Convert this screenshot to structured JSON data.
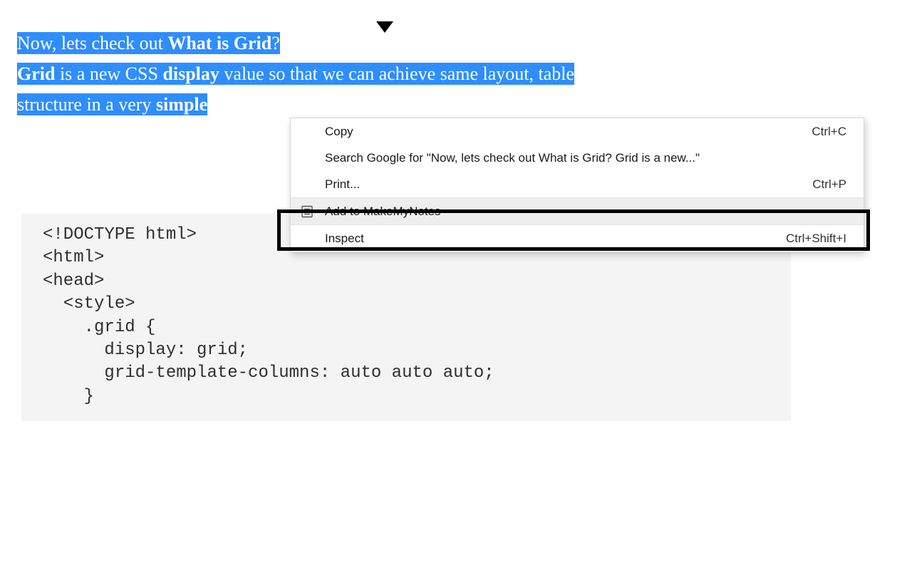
{
  "article": {
    "line1_prefix": "Now, lets check out ",
    "line1_bold": "What is Grid",
    "line1_suffix": "?",
    "line2_bold1": "Grid",
    "line2_mid1": " is a new CSS ",
    "line2_bold2": "display",
    "line2_mid2": " value so that we can achieve same layout, table",
    "line3_prefix": "structure in a very ",
    "line3_bold": "simple",
    "line3_suffix": " "
  },
  "code": "<!DOCTYPE html>\n<html>\n<head>\n  <style>\n    .grid {\n      display: grid;\n      grid-template-columns: auto auto auto;\n    }",
  "menu": {
    "copy": {
      "label": "Copy",
      "shortcut": "Ctrl+C"
    },
    "search": {
      "label": "Search Google for \"Now, lets check out What is Grid? Grid is a new...\""
    },
    "print": {
      "label": "Print...",
      "shortcut": "Ctrl+P"
    },
    "addnotes": {
      "label": "Add to MakeMyNotes"
    },
    "inspect": {
      "label": "Inspect",
      "shortcut": "Ctrl+Shift+I"
    }
  }
}
